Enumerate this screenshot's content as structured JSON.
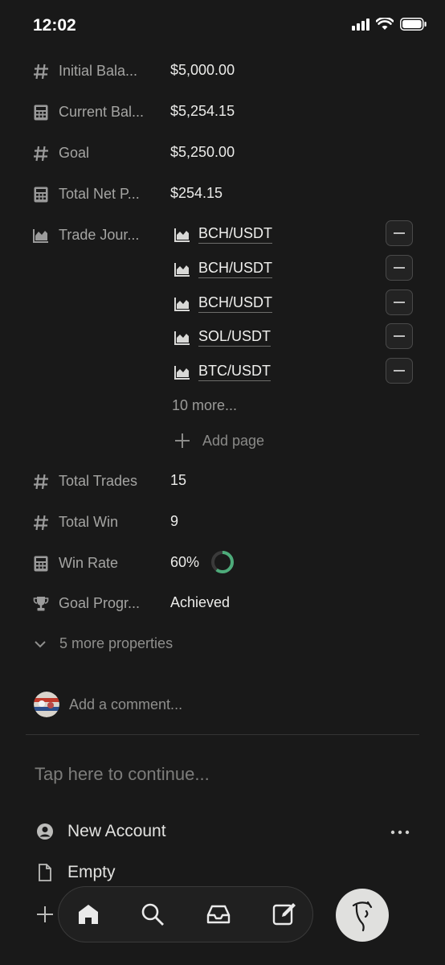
{
  "status_bar": {
    "time": "12:02"
  },
  "properties": [
    {
      "icon": "hash-icon",
      "name": "Initial Bala...",
      "value": "$5,000.00"
    },
    {
      "icon": "calculator-icon",
      "name": "Current Bal...",
      "value": "$5,254.15"
    },
    {
      "icon": "hash-icon",
      "name": "Goal",
      "value": "$5,250.00"
    },
    {
      "icon": "calculator-icon",
      "name": "Total Net P...",
      "value": "$254.15"
    },
    {
      "icon": "chart-icon",
      "name": "Trade Jour..."
    }
  ],
  "trade_journal": {
    "items": [
      "BCH/USDT",
      "BCH/USDT",
      "BCH/USDT",
      "SOL/USDT",
      "BTC/USDT"
    ],
    "more_label": "10 more...",
    "add_page_label": "Add page"
  },
  "properties2": [
    {
      "icon": "hash-icon",
      "name": "Total Trades",
      "value": "15"
    },
    {
      "icon": "hash-icon",
      "name": "Total Win",
      "value": "9"
    },
    {
      "icon": "calculator-icon",
      "name": "Win Rate",
      "value": "60%"
    },
    {
      "icon": "trophy-icon",
      "name": "Goal Progr...",
      "value": "Achieved"
    }
  ],
  "win_rate_progress": 0.6,
  "more_properties_label": "5 more properties",
  "comment_placeholder": "Add a comment...",
  "tap_placeholder": "Tap here to continue...",
  "rows": [
    {
      "icon": "user-circle-icon",
      "label": "New Account"
    },
    {
      "icon": "page-icon",
      "label": "Empty"
    }
  ],
  "colors": {
    "background": "#191919",
    "progress": "#4dab7a",
    "fab": "#e0e0de"
  },
  "nav": [
    "home-icon",
    "search-icon",
    "inbox-icon",
    "compose-icon"
  ]
}
